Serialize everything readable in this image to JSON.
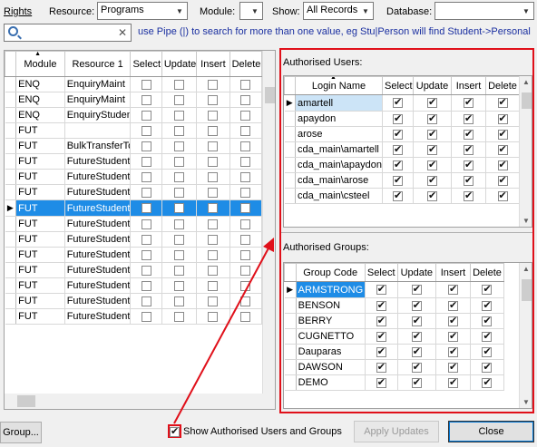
{
  "filters": {
    "rights_label": "Rights",
    "resource_label": "Resource:",
    "resource_value": "Programs",
    "module_label": "Module:",
    "module_value": "",
    "show_label": "Show:",
    "show_value": "All Records",
    "database_label": "Database:",
    "database_value": ""
  },
  "search": {
    "value": "",
    "clear_glyph": "✕",
    "hint": "use Pipe (|) to search for more than one value, eg Stu|Person will find Student->Personal"
  },
  "programs_grid": {
    "columns": [
      "Module",
      "Resource 1",
      "Select",
      "Update",
      "Insert",
      "Delete"
    ],
    "selected_index": 8,
    "rows": [
      {
        "module": "ENQ",
        "resource": "EnquiryMaint"
      },
      {
        "module": "ENQ",
        "resource": "EnquiryMaint"
      },
      {
        "module": "ENQ",
        "resource": "EnquiryStuden"
      },
      {
        "module": "FUT",
        "resource": ""
      },
      {
        "module": "FUT",
        "resource": "BulkTransferTo"
      },
      {
        "module": "FUT",
        "resource": "FutureStudent"
      },
      {
        "module": "FUT",
        "resource": "FutureStudent"
      },
      {
        "module": "FUT",
        "resource": "FutureStudent"
      },
      {
        "module": "FUT",
        "resource": "FutureStudent"
      },
      {
        "module": "FUT",
        "resource": "FutureStudent"
      },
      {
        "module": "FUT",
        "resource": "FutureStudent"
      },
      {
        "module": "FUT",
        "resource": "FutureStudent"
      },
      {
        "module": "FUT",
        "resource": "FutureStudent"
      },
      {
        "module": "FUT",
        "resource": "FutureStudent"
      },
      {
        "module": "FUT",
        "resource": "FutureStudent"
      },
      {
        "module": "FUT",
        "resource": "FutureStudent"
      }
    ]
  },
  "authorised_users": {
    "label": "Authorised Users:",
    "columns": [
      "Login Name",
      "Select",
      "Update",
      "Insert",
      "Delete"
    ],
    "rows": [
      {
        "name": "amartell",
        "select": true,
        "update": true,
        "insert": true,
        "delete": true
      },
      {
        "name": "apaydon",
        "select": true,
        "update": true,
        "insert": true,
        "delete": true
      },
      {
        "name": "arose",
        "select": true,
        "update": true,
        "insert": true,
        "delete": true
      },
      {
        "name": "cda_main\\amartell",
        "select": true,
        "update": true,
        "insert": true,
        "delete": true
      },
      {
        "name": "cda_main\\apaydon",
        "select": true,
        "update": true,
        "insert": true,
        "delete": true
      },
      {
        "name": "cda_main\\arose",
        "select": true,
        "update": true,
        "insert": true,
        "delete": true
      },
      {
        "name": "cda_main\\csteel",
        "select": true,
        "update": true,
        "insert": true,
        "delete": true
      }
    ]
  },
  "authorised_groups": {
    "label": "Authorised Groups:",
    "columns": [
      "Group Code",
      "Select",
      "Update",
      "Insert",
      "Delete"
    ],
    "rows": [
      {
        "name": "ARMSTRONG",
        "select": true,
        "update": true,
        "insert": true,
        "delete": true
      },
      {
        "name": "BENSON",
        "select": true,
        "update": true,
        "insert": true,
        "delete": true
      },
      {
        "name": "BERRY",
        "select": true,
        "update": true,
        "insert": true,
        "delete": true
      },
      {
        "name": "CUGNETTO",
        "select": true,
        "update": true,
        "insert": true,
        "delete": true
      },
      {
        "name": "Dauparas",
        "select": true,
        "update": true,
        "insert": true,
        "delete": true
      },
      {
        "name": "DAWSON",
        "select": true,
        "update": true,
        "insert": true,
        "delete": true
      },
      {
        "name": "DEMO",
        "select": true,
        "update": true,
        "insert": true,
        "delete": true
      }
    ]
  },
  "footer": {
    "group_button": "Group...",
    "show_authorised_label": "Show Authorised Users and Groups",
    "show_authorised_checked": true,
    "apply_button": "Apply Updates",
    "close_button": "Close"
  },
  "colors": {
    "highlight": "#1e8ce6",
    "annotation_red": "#e0101a"
  }
}
